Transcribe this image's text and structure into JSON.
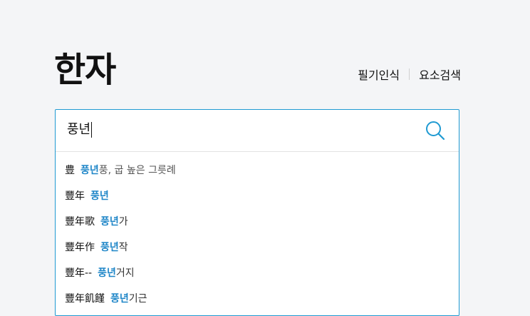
{
  "header": {
    "title": "한자",
    "links": [
      "필기인식",
      "요소검색"
    ]
  },
  "search": {
    "value": "풍년"
  },
  "suggestions": [
    {
      "hanja": "豊",
      "highlight": "풍년",
      "rest": "풍, 굽 높은 그릇례"
    },
    {
      "hanja": "豐年",
      "highlight": "풍년",
      "rest": ""
    },
    {
      "hanja": "豐年歌",
      "highlight": "풍년",
      "rest": "가"
    },
    {
      "hanja": "豐年作",
      "highlight": "풍년",
      "rest": "작"
    },
    {
      "hanja": "豐年--",
      "highlight": "풍년",
      "rest": "거지"
    },
    {
      "hanja": "豐年飢饉",
      "highlight": "풍년",
      "rest": "기근"
    }
  ],
  "colors": {
    "accent": "#1f9ad2",
    "highlight": "#1f86c8",
    "background": "#f4f5f7"
  },
  "icons": {
    "search": "search-icon"
  }
}
